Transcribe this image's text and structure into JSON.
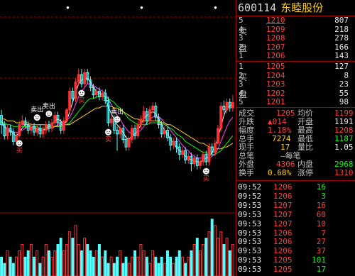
{
  "stock": {
    "code": "600114",
    "name": "东睦股份"
  },
  "chart_data": {
    "type": "candlestick",
    "price_bars": [
      {
        "o": 4.1,
        "c": 3.6,
        "h": 4.4,
        "l": 3.1
      },
      {
        "o": 3.6,
        "c": 3.0,
        "h": 3.8,
        "l": 2.8
      },
      {
        "o": 3.0,
        "c": 3.4,
        "h": 3.6,
        "l": 2.8
      },
      {
        "o": 3.4,
        "c": 3.2,
        "h": 3.6,
        "l": 3.0
      },
      {
        "o": 3.2,
        "c": 2.7,
        "h": 3.4,
        "l": 2.5
      },
      {
        "o": 2.7,
        "c": 3.0,
        "h": 3.2,
        "l": 2.5
      },
      {
        "o": 3.0,
        "c": 3.6,
        "h": 3.8,
        "l": 2.9
      },
      {
        "o": 3.6,
        "c": 3.8,
        "h": 4.1,
        "l": 3.4
      },
      {
        "o": 3.8,
        "c": 3.6,
        "h": 4.0,
        "l": 3.4
      },
      {
        "o": 3.6,
        "c": 3.3,
        "h": 3.8,
        "l": 3.1
      },
      {
        "o": 3.3,
        "c": 3.5,
        "h": 3.7,
        "l": 3.1
      },
      {
        "o": 3.5,
        "c": 3.2,
        "h": 3.7,
        "l": 3.0
      },
      {
        "o": 3.2,
        "c": 3.4,
        "h": 3.6,
        "l": 3.0
      },
      {
        "o": 3.4,
        "c": 3.1,
        "h": 3.6,
        "l": 2.9
      },
      {
        "o": 3.1,
        "c": 3.3,
        "h": 3.5,
        "l": 2.9
      },
      {
        "o": 3.3,
        "c": 3.6,
        "h": 3.8,
        "l": 3.1
      },
      {
        "o": 3.6,
        "c": 3.4,
        "h": 3.8,
        "l": 3.2
      },
      {
        "o": 3.4,
        "c": 3.7,
        "h": 3.9,
        "l": 3.2
      },
      {
        "o": 3.7,
        "c": 4.1,
        "h": 4.3,
        "l": 3.5
      },
      {
        "o": 4.1,
        "c": 3.7,
        "h": 4.3,
        "l": 3.5
      },
      {
        "o": 3.7,
        "c": 3.3,
        "h": 3.9,
        "l": 3.1
      },
      {
        "o": 3.3,
        "c": 3.8,
        "h": 4.0,
        "l": 3.1
      },
      {
        "o": 3.8,
        "c": 4.4,
        "h": 4.5,
        "l": 3.6
      },
      {
        "o": 4.4,
        "c": 5.4,
        "h": 5.6,
        "l": 4.2
      },
      {
        "o": 5.4,
        "c": 5.0,
        "h": 5.6,
        "l": 4.8
      },
      {
        "o": 5.0,
        "c": 5.9,
        "h": 6.1,
        "l": 4.8
      },
      {
        "o": 5.9,
        "c": 6.3,
        "h": 6.6,
        "l": 5.7
      },
      {
        "o": 6.3,
        "c": 5.8,
        "h": 6.6,
        "l": 5.6
      },
      {
        "o": 5.8,
        "c": 6.4,
        "h": 6.6,
        "l": 5.6
      },
      {
        "o": 6.4,
        "c": 6.0,
        "h": 6.6,
        "l": 5.8
      },
      {
        "o": 6.0,
        "c": 5.6,
        "h": 6.2,
        "l": 5.4
      },
      {
        "o": 5.6,
        "c": 5.2,
        "h": 5.8,
        "l": 5.0
      },
      {
        "o": 5.2,
        "c": 5.4,
        "h": 5.6,
        "l": 5.0
      },
      {
        "o": 5.4,
        "c": 5.1,
        "h": 5.6,
        "l": 4.9
      },
      {
        "o": 5.1,
        "c": 5.3,
        "h": 5.5,
        "l": 4.9
      },
      {
        "o": 5.3,
        "c": 4.9,
        "h": 5.5,
        "l": 4.7
      },
      {
        "o": 4.9,
        "c": 3.7,
        "h": 5.1,
        "l": 3.5
      },
      {
        "o": 3.7,
        "c": 3.9,
        "h": 4.1,
        "l": 3.5
      },
      {
        "o": 3.9,
        "c": 3.3,
        "h": 4.1,
        "l": 3.1
      },
      {
        "o": 3.3,
        "c": 3.1,
        "h": 3.5,
        "l": 2.2
      },
      {
        "o": 3.1,
        "c": 3.4,
        "h": 3.6,
        "l": 2.9
      },
      {
        "o": 3.4,
        "c": 2.8,
        "h": 3.6,
        "l": 2.6
      },
      {
        "o": 2.8,
        "c": 2.4,
        "h": 3.0,
        "l": 2.2
      },
      {
        "o": 2.4,
        "c": 2.8,
        "h": 3.0,
        "l": 2.2
      },
      {
        "o": 2.8,
        "c": 3.4,
        "h": 3.6,
        "l": 2.6
      },
      {
        "o": 3.4,
        "c": 3.0,
        "h": 3.6,
        "l": 2.8
      },
      {
        "o": 3.0,
        "c": 3.6,
        "h": 3.8,
        "l": 2.9
      },
      {
        "o": 3.6,
        "c": 3.9,
        "h": 4.1,
        "l": 3.4
      },
      {
        "o": 3.9,
        "c": 4.3,
        "h": 4.6,
        "l": 3.7
      },
      {
        "o": 4.3,
        "c": 3.8,
        "h": 4.5,
        "l": 3.6
      },
      {
        "o": 3.8,
        "c": 4.4,
        "h": 4.6,
        "l": 3.6
      },
      {
        "o": 4.4,
        "c": 4.6,
        "h": 4.8,
        "l": 4.2
      },
      {
        "o": 4.6,
        "c": 4.0,
        "h": 4.8,
        "l": 3.8
      },
      {
        "o": 4.0,
        "c": 3.6,
        "h": 4.2,
        "l": 3.4
      },
      {
        "o": 3.6,
        "c": 3.1,
        "h": 3.8,
        "l": 2.9
      },
      {
        "o": 3.1,
        "c": 3.3,
        "h": 3.5,
        "l": 2.9
      },
      {
        "o": 3.3,
        "c": 2.9,
        "h": 3.5,
        "l": 2.7
      },
      {
        "o": 2.9,
        "c": 2.5,
        "h": 3.1,
        "l": 2.2
      },
      {
        "o": 2.5,
        "c": 2.7,
        "h": 2.9,
        "l": 2.3
      },
      {
        "o": 2.7,
        "c": 2.4,
        "h": 2.9,
        "l": 2.1
      },
      {
        "o": 2.4,
        "c": 2.0,
        "h": 2.6,
        "l": 1.7
      },
      {
        "o": 2.0,
        "c": 2.2,
        "h": 2.4,
        "l": 1.8
      },
      {
        "o": 2.2,
        "c": 1.7,
        "h": 2.4,
        "l": 1.5
      },
      {
        "o": 1.7,
        "c": 1.9,
        "h": 2.1,
        "l": 1.5
      },
      {
        "o": 1.9,
        "c": 1.5,
        "h": 2.1,
        "l": 1.1
      },
      {
        "o": 1.5,
        "c": 1.8,
        "h": 2.0,
        "l": 1.3
      },
      {
        "o": 1.8,
        "c": 1.4,
        "h": 2.0,
        "l": 1.2
      },
      {
        "o": 1.4,
        "c": 1.6,
        "h": 1.8,
        "l": 1.2
      },
      {
        "o": 1.6,
        "c": 2.0,
        "h": 2.2,
        "l": 1.4
      },
      {
        "o": 2.0,
        "c": 1.6,
        "h": 2.2,
        "l": 1.4
      },
      {
        "o": 1.6,
        "c": 2.4,
        "h": 2.6,
        "l": 1.4
      },
      {
        "o": 2.4,
        "c": 2.1,
        "h": 2.6,
        "l": 1.9
      },
      {
        "o": 2.1,
        "c": 2.6,
        "h": 2.8,
        "l": 1.9
      },
      {
        "o": 2.6,
        "c": 3.4,
        "h": 3.6,
        "l": 2.5
      },
      {
        "o": 3.4,
        "c": 4.6,
        "h": 4.8,
        "l": 3.2
      },
      {
        "o": 4.6,
        "c": 4.4,
        "h": 4.9,
        "l": 4.2
      },
      {
        "o": 4.4,
        "c": 4.8,
        "h": 5.0,
        "l": 4.2
      },
      {
        "o": 4.8,
        "c": 4.5,
        "h": 5.0,
        "l": 4.3
      },
      {
        "o": 4.5,
        "c": 4.8,
        "h": 5.2,
        "l": 4.3
      }
    ],
    "price_range": [
      0,
      10
    ],
    "moving_averages": [
      {
        "color": "#ffffff",
        "values": [
          3.8,
          3.5,
          3.3,
          3.3,
          3.1,
          3.0,
          3.2,
          3.4,
          3.6,
          3.6,
          3.5,
          3.4,
          3.4,
          3.3,
          3.3,
          3.4,
          3.5,
          3.6,
          3.8,
          3.9,
          3.8,
          3.6,
          3.8,
          4.3,
          4.8,
          5.3,
          5.8,
          6.0,
          6.1,
          6.1,
          5.9,
          5.6,
          5.4,
          5.3,
          5.2,
          5.1,
          4.6,
          4.2,
          3.9,
          3.6,
          3.4,
          3.2,
          2.9,
          2.8,
          3.0,
          3.1,
          3.3,
          3.6,
          3.9,
          4.1,
          4.2,
          4.3,
          4.2,
          3.9,
          3.6,
          3.3,
          3.1,
          2.8,
          2.6,
          2.4,
          2.2,
          2.1,
          1.9,
          1.8,
          1.7,
          1.7,
          1.6,
          1.6,
          1.7,
          1.8,
          1.9,
          2.1,
          2.4,
          2.9,
          3.5,
          4.1,
          4.5,
          4.6,
          4.7
        ]
      },
      {
        "color": "#ff40ff",
        "values": [
          3.6,
          3.5,
          3.4,
          3.3,
          3.2,
          3.2,
          3.2,
          3.3,
          3.4,
          3.5,
          3.5,
          3.5,
          3.4,
          3.4,
          3.3,
          3.3,
          3.4,
          3.4,
          3.5,
          3.6,
          3.7,
          3.7,
          3.8,
          4.0,
          4.3,
          4.7,
          5.1,
          5.4,
          5.6,
          5.8,
          5.8,
          5.7,
          5.6,
          5.5,
          5.4,
          5.3,
          5.0,
          4.7,
          4.4,
          4.1,
          3.9,
          3.6,
          3.4,
          3.2,
          3.1,
          3.1,
          3.2,
          3.3,
          3.5,
          3.7,
          3.9,
          4.0,
          4.1,
          4.0,
          3.9,
          3.7,
          3.5,
          3.3,
          3.1,
          2.9,
          2.7,
          2.5,
          2.3,
          2.2,
          2.0,
          1.9,
          1.8,
          1.8,
          1.8,
          1.8,
          1.8,
          1.9,
          2.0,
          2.3,
          2.7,
          3.1,
          3.5,
          3.8,
          4.0
        ]
      },
      {
        "color": "#00ff00",
        "values": [
          3.7,
          3.7,
          3.6,
          3.6,
          3.5,
          3.5,
          3.5,
          3.5,
          3.5,
          3.5,
          3.5,
          3.5,
          3.5,
          3.4,
          3.4,
          3.4,
          3.4,
          3.4,
          3.5,
          3.5,
          3.5,
          3.6,
          3.6,
          3.7,
          3.9,
          4.1,
          4.3,
          4.5,
          4.7,
          4.9,
          5.0,
          5.0,
          5.1,
          5.1,
          5.1,
          5.1,
          5.0,
          4.9,
          4.8,
          4.6,
          4.5,
          4.3,
          4.1,
          3.9,
          3.8,
          3.7,
          3.6,
          3.6,
          3.6,
          3.6,
          3.7,
          3.7,
          3.7,
          3.7,
          3.7,
          3.6,
          3.5,
          3.4,
          3.3,
          3.1,
          3.0,
          2.9,
          2.7,
          2.6,
          2.5,
          2.4,
          2.3,
          2.2,
          2.1,
          2.1,
          2.0,
          2.0,
          2.0,
          2.1,
          2.2,
          2.4,
          2.6,
          2.8,
          3.0
        ]
      },
      {
        "color": "#ffd000",
        "values": [
          3.9,
          3.9,
          3.8,
          3.8,
          3.8,
          3.7,
          3.7,
          3.7,
          3.7,
          3.7,
          3.6,
          3.6,
          3.6,
          3.6,
          3.6,
          3.6,
          3.5,
          3.5,
          3.5,
          3.5,
          3.6,
          3.6,
          3.6,
          3.6,
          3.7,
          3.8,
          3.9,
          4.0,
          4.1,
          4.2,
          4.3,
          4.4,
          4.5,
          4.5,
          4.6,
          4.6,
          4.6,
          4.6,
          4.5,
          4.5,
          4.4,
          4.3,
          4.2,
          4.1,
          4.0,
          3.9,
          3.9,
          3.8,
          3.8,
          3.8,
          3.8,
          3.8,
          3.8,
          3.8,
          3.7,
          3.7,
          3.6,
          3.6,
          3.5,
          3.4,
          3.3,
          3.2,
          3.1,
          3.0,
          2.9,
          2.8,
          2.7,
          2.6,
          2.6,
          2.5,
          2.4,
          2.4,
          2.3,
          2.3,
          2.3,
          2.4,
          2.4,
          2.5,
          2.6
        ]
      }
    ],
    "signals": [
      {
        "bar": 6,
        "type": "buy",
        "label": "买"
      },
      {
        "bar": 12,
        "type": "sell",
        "label": "卖出"
      },
      {
        "bar": 16,
        "type": "sell",
        "label": "卖出"
      },
      {
        "bar": 27,
        "type": "buy",
        "label": "买"
      },
      {
        "bar": 36,
        "type": "buy",
        "label": "买"
      },
      {
        "bar": 39,
        "type": "sell",
        "label": "卖出"
      },
      {
        "bar": 69,
        "type": "buy",
        "label": "买"
      }
    ],
    "volume_range": [
      0,
      10
    ],
    "volumes": [
      3,
      2,
      4,
      3,
      2,
      3,
      4,
      5,
      3,
      4,
      5,
      3,
      4,
      2,
      3,
      5,
      4,
      3,
      4,
      5,
      6,
      4,
      5,
      7,
      6,
      8,
      5,
      4,
      6,
      5,
      4,
      3,
      4,
      5,
      3,
      4,
      2,
      3,
      2,
      3,
      4,
      2,
      3,
      2,
      3,
      4,
      3,
      5,
      4,
      3,
      2,
      4,
      3,
      2,
      3,
      2,
      4,
      3,
      2,
      3,
      4,
      3,
      2,
      3,
      4,
      5,
      6,
      4,
      5,
      6,
      7,
      9,
      8,
      6,
      7,
      5,
      6,
      4,
      5
    ]
  },
  "order_book": {
    "sell_label_1": "卖",
    "sell_label_2": "盘",
    "buy_label_1": "买",
    "buy_label_2": "盘",
    "asks": [
      {
        "level": "5",
        "price": "1210",
        "vol": "807"
      },
      {
        "level": "4",
        "price": "1209",
        "vol": "218"
      },
      {
        "level": "3",
        "price": "1208",
        "vol": "278"
      },
      {
        "level": "2",
        "price": "1207",
        "vol": "166"
      },
      {
        "level": "1",
        "price": "1206",
        "vol": "143"
      }
    ],
    "bids": [
      {
        "level": "1",
        "price": "1205",
        "vol": "127"
      },
      {
        "level": "2",
        "price": "1204",
        "vol": "8"
      },
      {
        "level": "3",
        "price": "1203",
        "vol": "23"
      },
      {
        "level": "4",
        "price": "1202",
        "vol": "55"
      },
      {
        "level": "5",
        "price": "1201",
        "vol": "98"
      }
    ]
  },
  "stats": {
    "chengjiao_label": "成交",
    "chengjiao_val": "1205",
    "junjia_label": "均价",
    "junjia_val": "1199",
    "shengdie_label": "升跌",
    "shengdie_val": "▲014",
    "kaipan_label": "开盘",
    "kaipan_val": "1191",
    "fudu_label": "幅度",
    "fudu_val": "1.18%",
    "zuigao_label": "最高",
    "zuigao_val": "1208",
    "zongshou_label": "总手",
    "zongshou_val": "7274",
    "zuidi_label": "最低",
    "zuidi_val": "1187",
    "xianshou_label": "现手",
    "xianshou_val": "17",
    "liangbi_label": "量比",
    "liangbi_val": "1.05",
    "zongbi_label": "总笔",
    "zongbi_val": "—每笔",
    "waipan_label": "外盘",
    "waipan_val": "4306",
    "neipan_label": "内盘",
    "neipan_val": "2968",
    "huanshou_label": "换手",
    "huanshou_val": "0.68%",
    "zhangting_label": "涨停",
    "zhangting_val": "1310"
  },
  "ticks": [
    {
      "time": "09:52",
      "price": "1206",
      "vol": "16",
      "color": "#00ff00"
    },
    {
      "time": "09:52",
      "price": "1206",
      "vol": "3",
      "color": "#00ff00"
    },
    {
      "time": "09:53",
      "price": "1207",
      "vol": "16",
      "color": "#ff3c3c"
    },
    {
      "time": "09:53",
      "price": "1207",
      "vol": "60",
      "color": "#ff3c3c"
    },
    {
      "time": "09:53",
      "price": "1207",
      "vol": "10",
      "color": "#ff3c3c"
    },
    {
      "time": "09:53",
      "price": "1206",
      "vol": "7",
      "color": "#ff3c3c"
    },
    {
      "time": "09:53",
      "price": "1206",
      "vol": "27",
      "color": "#ff3c3c"
    },
    {
      "time": "09:53",
      "price": "1206",
      "vol": "37",
      "color": "#ff3c3c"
    },
    {
      "time": "09:53",
      "price": "1205",
      "vol": "101",
      "color": "#00ff00"
    },
    {
      "time": "09:53",
      "price": "1205",
      "vol": "17",
      "color": "#00ff00"
    }
  ]
}
